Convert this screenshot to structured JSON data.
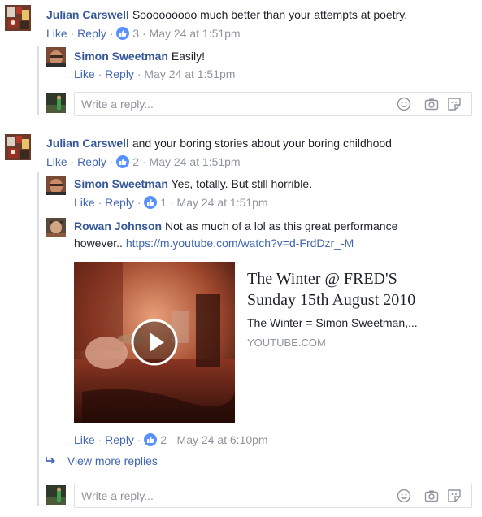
{
  "threads": [
    {
      "author": "Julian Carswell",
      "text": "Sooooooooo much better than your attempts at poetry.",
      "like": "Like",
      "reply": "Reply",
      "reactions": "3",
      "time": "May 24 at 1:51pm",
      "replies": [
        {
          "author": "Simon Sweetman",
          "text": "Easily!",
          "like": "Like",
          "reply": "Reply",
          "time": "May 24 at 1:51pm"
        }
      ],
      "reply_placeholder": "Write a reply..."
    },
    {
      "author": "Julian Carswell",
      "text": "and your boring stories about your boring childhood",
      "like": "Like",
      "reply": "Reply",
      "reactions": "2",
      "time": "May 24 at 1:51pm",
      "replies": [
        {
          "author": "Simon Sweetman",
          "text": "Yes, totally. But still horrible.",
          "like": "Like",
          "reply": "Reply",
          "reactions": "1",
          "time": "May 24 at 1:51pm"
        },
        {
          "author": "Rowan Johnson",
          "text_line1": "Not as much of a lol as this great performance",
          "text_line2": "however..",
          "link": "https://m.youtube.com/watch?v=d-FrdDzr_-M",
          "like": "Like",
          "reply": "Reply",
          "reactions": "2",
          "time": "May 24 at 6:10pm",
          "preview": {
            "title_line1": "The Winter @ FRED'S",
            "title_line2": "Sunday 15th August 2010",
            "description": "The Winter = Simon Sweetman,...",
            "domain": "YOUTUBE.COM"
          }
        }
      ],
      "view_more": "View more replies",
      "reply_placeholder": "Write a reply..."
    }
  ],
  "colors": {
    "name": "#365899",
    "meta": "#90949c",
    "link": "#4267b2",
    "like_badge": "#5890ff"
  },
  "icons": [
    "like-icon",
    "emoji-icon",
    "camera-icon",
    "sticker-icon",
    "reply-arrow-icon",
    "play-icon"
  ]
}
